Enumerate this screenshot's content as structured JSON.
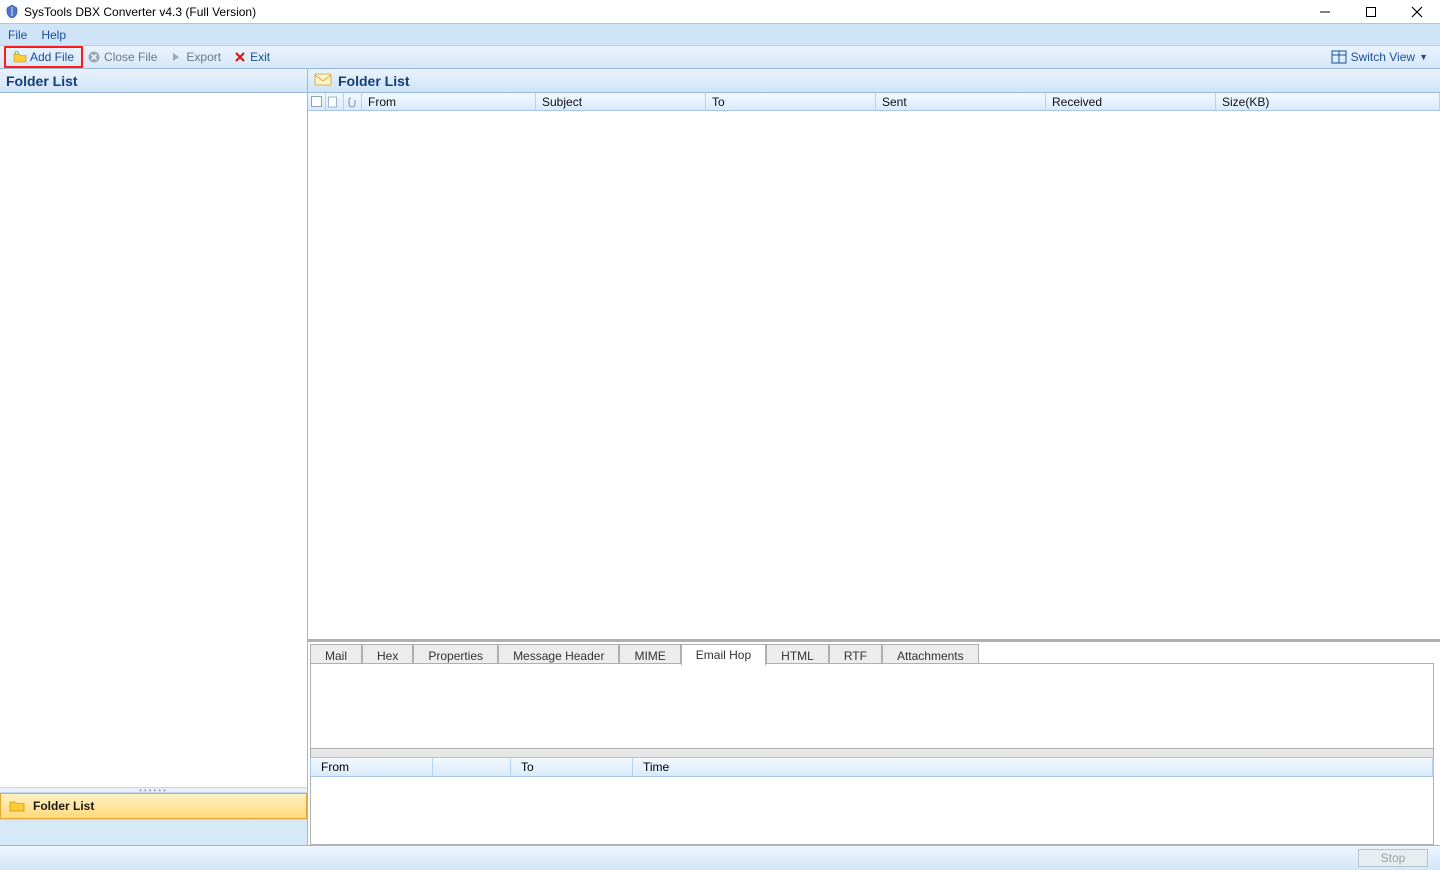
{
  "title": "SysTools DBX Converter v4.3 (Full Version)",
  "menu": {
    "file": "File",
    "help": "Help"
  },
  "toolbar": {
    "add_file": "Add File",
    "close_file": "Close File",
    "export": "Export",
    "exit": "Exit",
    "switch_view": "Switch View"
  },
  "left": {
    "header": "Folder List",
    "nav_item": "Folder List"
  },
  "right": {
    "header": "Folder List",
    "columns": {
      "from": "From",
      "subject": "Subject",
      "to": "To",
      "sent": "Sent",
      "received": "Received",
      "size": "Size(KB)"
    }
  },
  "tabs": {
    "mail": "Mail",
    "hex": "Hex",
    "properties": "Properties",
    "message_header": "Message Header",
    "mime": "MIME",
    "email_hop": "Email Hop",
    "html": "HTML",
    "rtf": "RTF",
    "attachments": "Attachments",
    "active": "email_hop"
  },
  "hop_columns": {
    "from": "From",
    "to": "To",
    "time": "Time"
  },
  "status": {
    "stop": "Stop"
  }
}
